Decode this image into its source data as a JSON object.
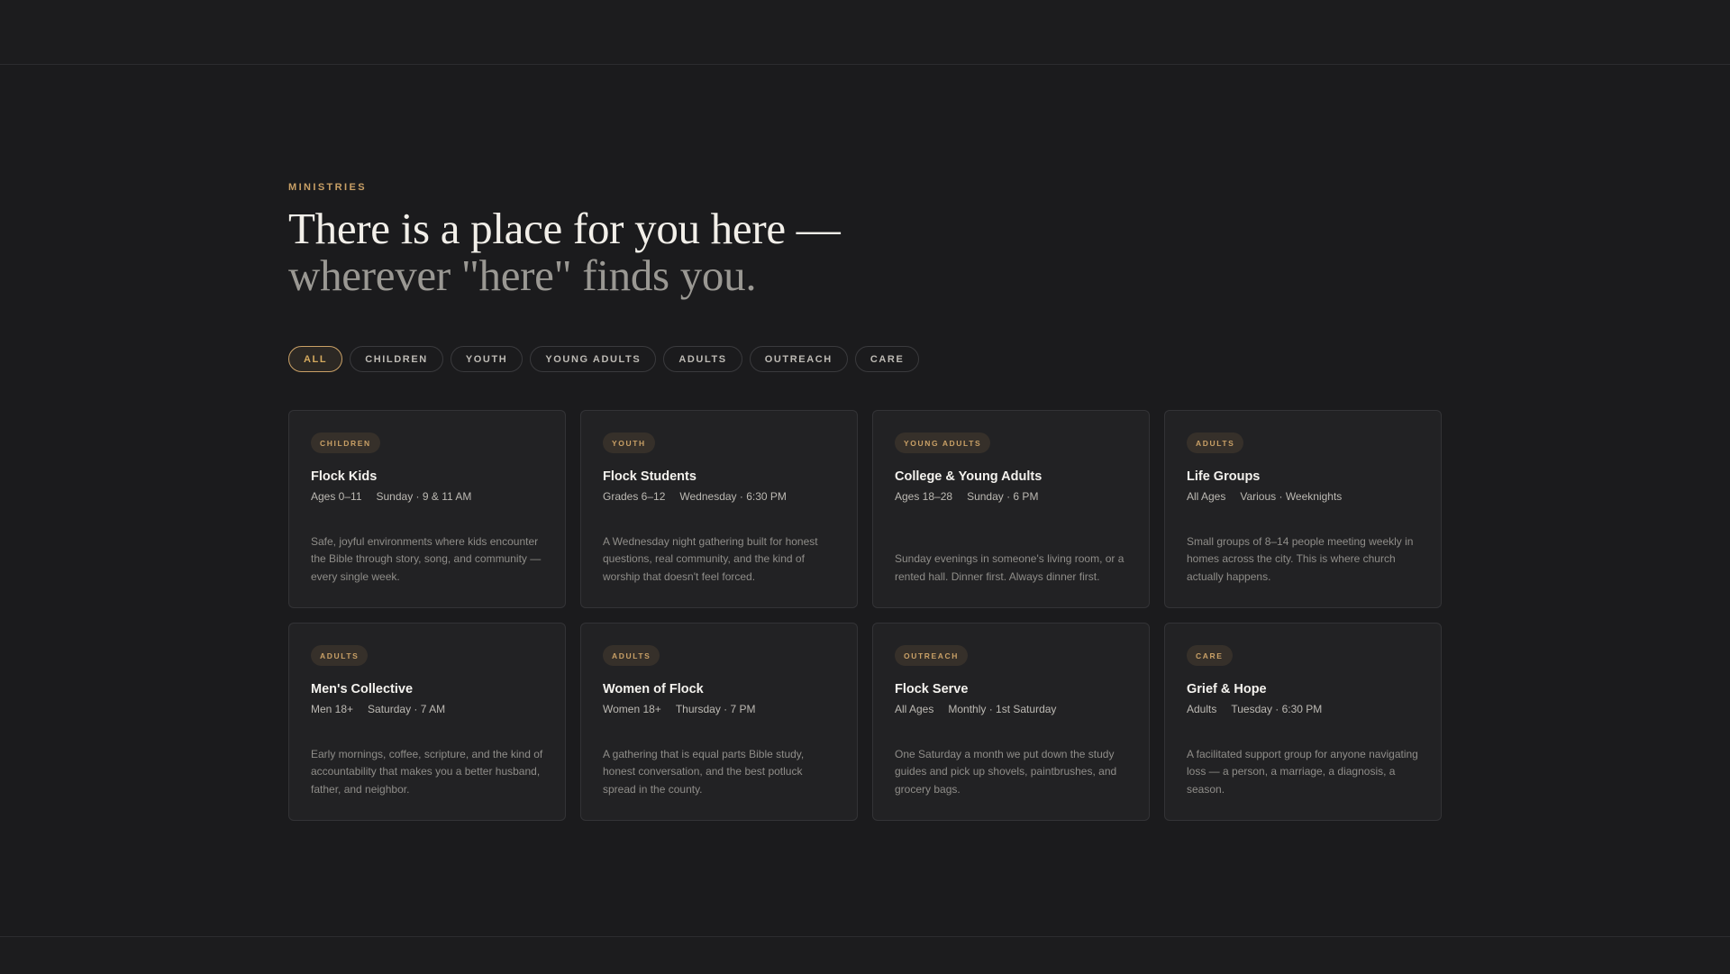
{
  "section": {
    "eyebrow": "MINISTRIES",
    "headline_line1": "There is a place for you here —",
    "headline_line2": "wherever \"here\" finds you."
  },
  "filters": [
    {
      "label": "ALL",
      "active": true
    },
    {
      "label": "CHILDREN",
      "active": false
    },
    {
      "label": "YOUTH",
      "active": false
    },
    {
      "label": "YOUNG ADULTS",
      "active": false
    },
    {
      "label": "ADULTS",
      "active": false
    },
    {
      "label": "OUTREACH",
      "active": false
    },
    {
      "label": "CARE",
      "active": false
    }
  ],
  "cards": [
    {
      "tag": "CHILDREN",
      "title": "Flock Kids",
      "audience": "Ages 0–11",
      "schedule": "Sunday · 9 & 11 AM",
      "description": "Safe, joyful environments where kids encounter the Bible through story, song, and community — every single week."
    },
    {
      "tag": "YOUTH",
      "title": "Flock Students",
      "audience": "Grades 6–12",
      "schedule": "Wednesday · 6:30 PM",
      "description": "A Wednesday night gathering built for honest questions, real community, and the kind of worship that doesn't feel forced."
    },
    {
      "tag": "YOUNG ADULTS",
      "title": "College & Young Adults",
      "audience": "Ages 18–28",
      "schedule": "Sunday · 6 PM",
      "description": "Sunday evenings in someone's living room, or a rented hall. Dinner first. Always dinner first."
    },
    {
      "tag": "ADULTS",
      "title": "Life Groups",
      "audience": "All Ages",
      "schedule": "Various · Weeknights",
      "description": "Small groups of 8–14 people meeting weekly in homes across the city. This is where church actually happens."
    },
    {
      "tag": "ADULTS",
      "title": "Men's Collective",
      "audience": "Men 18+",
      "schedule": "Saturday · 7 AM",
      "description": "Early mornings, coffee, scripture, and the kind of accountability that makes you a better husband, father, and neighbor."
    },
    {
      "tag": "ADULTS",
      "title": "Women of Flock",
      "audience": "Women 18+",
      "schedule": "Thursday · 7 PM",
      "description": "A gathering that is equal parts Bible study, honest conversation, and the best potluck spread in the county."
    },
    {
      "tag": "OUTREACH",
      "title": "Flock Serve",
      "audience": "All Ages",
      "schedule": "Monthly · 1st Saturday",
      "description": "One Saturday a month we put down the study guides and pick up shovels, paintbrushes, and grocery bags."
    },
    {
      "tag": "CARE",
      "title": "Grief & Hope",
      "audience": "Adults",
      "schedule": "Tuesday · 6:30 PM",
      "description": "A facilitated support group for anyone navigating loss — a person, a marriage, a diagnosis, a season."
    }
  ]
}
